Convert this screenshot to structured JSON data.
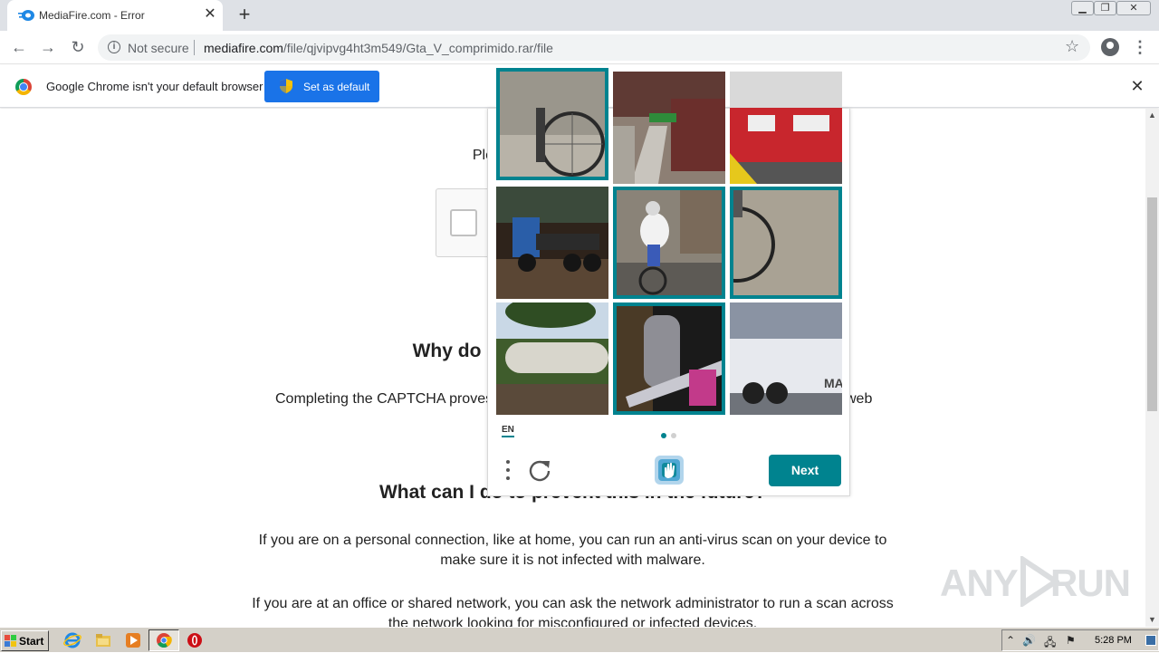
{
  "browser": {
    "tab": {
      "title": "MediaFire.com - Error"
    },
    "new_tab_symbol": "+",
    "address": {
      "security_label": "Not secure",
      "url_host": "mediafire.com",
      "url_path": "/file/qjvipvg4ht3m549/Gta_V_comprimido.rar/file"
    },
    "infobar": {
      "message": "Google Chrome isn't your default browser",
      "button_label": "Set as default"
    }
  },
  "page": {
    "instruction_visible": "Please complete",
    "heading1_visible": "Why do I ha",
    "paragraph1_left": "Completing the CAPTCHA proves",
    "paragraph1_right": "web",
    "heading2_visible": "What can I do to prevent this in the future?",
    "paragraph2_line1": "If you are on a personal connection, like at home, you can run an anti-virus scan on your device to",
    "paragraph2_line2": "make sure it is not infected with malware.",
    "paragraph3_line1": "If you are at an office or shared network, you can ask the network administrator to run a scan across",
    "paragraph3_line2": "the network looking for misconfigured or infected devices."
  },
  "captcha_challenge": {
    "language": "EN",
    "next_label": "Next",
    "accent_color": "#00838f",
    "tiles": [
      {
        "subject": "bicycle",
        "selected": true
      },
      {
        "subject": "train platform",
        "selected": false
      },
      {
        "subject": "red train",
        "selected": false
      },
      {
        "subject": "blue truck",
        "selected": false
      },
      {
        "subject": "cyclist",
        "selected": true
      },
      {
        "subject": "bicycle wheel",
        "selected": true
      },
      {
        "subject": "tank trailer",
        "selected": false
      },
      {
        "subject": "bicycle closeup",
        "selected": true
      },
      {
        "subject": "truck trailer",
        "selected": false
      }
    ],
    "truck_text": "MA",
    "page_indicator": {
      "pages": 2,
      "current": 1
    }
  },
  "taskbar": {
    "start_label": "Start",
    "clock": "5:28 PM"
  },
  "watermark": {
    "left": "ANY",
    "right": "RUN"
  }
}
